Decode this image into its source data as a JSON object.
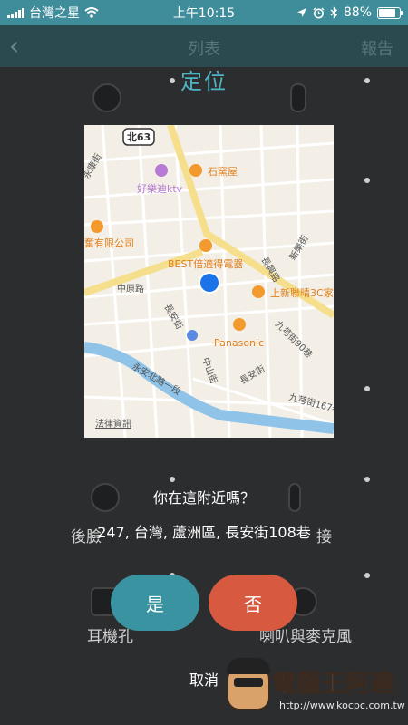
{
  "status_bar": {
    "carrier": "台灣之星",
    "time": "上午10:15",
    "battery_percent": "88%",
    "battery_level": 0.88,
    "icons": [
      "signal-icon",
      "wifi-icon",
      "location-arrow-icon",
      "alarm-icon",
      "bluetooth-icon",
      "battery-icon"
    ]
  },
  "background_screen": {
    "title": "列表",
    "right_action": "報告",
    "labels": {
      "row_left_1": "後臉",
      "row_right_1": "接",
      "row_left_2": "耳機孔",
      "row_right_2": "喇叭與麥克風"
    }
  },
  "dialog": {
    "title": "定位",
    "question": "你在這附近嗎？",
    "address": "247, 台灣, 蘆洲區, 長安街108巷",
    "yes_label": "是",
    "no_label": "否",
    "cancel_label": "取消"
  },
  "map": {
    "labels": {
      "route_shield": "北63",
      "poi_haolediktv": "好樂迪ktv",
      "poi_shiyaowu": "石窯屋",
      "poi_company": "奮有限公司",
      "poi_best": "BEST倍適得電器",
      "poi_shangxin": "上新聯晴3C家",
      "poi_panasonic": "Panasonic",
      "road_zhongyuan": "中原路",
      "road_changan": "長安街",
      "road_changxing": "長興路",
      "road_yonganbei_1": "永安北路一段",
      "road_zhongshan": "中山街",
      "road_jiuzhen": "九芎街",
      "road_jiuzhen_90": "九芎街90巷",
      "road_jiuzhen_167": "九芎街167巷",
      "road_yongkang": "永康街",
      "road_xinle": "新樂街",
      "road_changan_lower": "長安街",
      "legal_link": "法律資訊"
    },
    "colors": {
      "land": "#f3efe6",
      "road": "#ffffff",
      "major_road": "#f6df8c",
      "river": "#8fc3e8",
      "poi_orange": "#f29a2e",
      "poi_purple": "#b77bd6",
      "location_dot": "#1a73e8"
    }
  },
  "watermark": {
    "brand": "電腦王阿達",
    "url": "http://www.kocpc.com.tw"
  },
  "colors": {
    "accent": "#4fb4c4",
    "yes_button": "#3a93a1",
    "no_button": "#d75a40",
    "overlay_background": "#2c2d2f"
  }
}
